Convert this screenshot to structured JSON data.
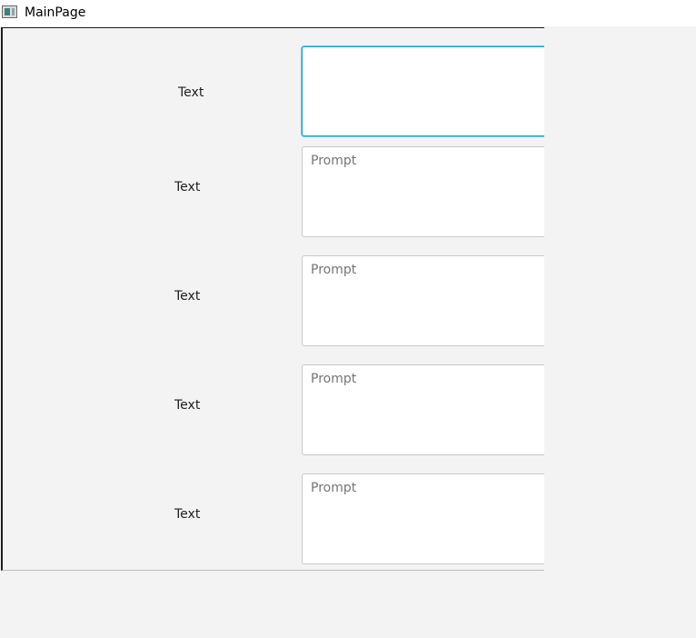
{
  "window": {
    "title": "MainPage"
  },
  "form": {
    "rows": [
      {
        "label": "Text",
        "value": "",
        "placeholder": ""
      },
      {
        "label": "Text",
        "value": "",
        "placeholder": "Prompt"
      },
      {
        "label": "Text",
        "value": "",
        "placeholder": "Prompt"
      },
      {
        "label": "Text",
        "value": "",
        "placeholder": "Prompt"
      },
      {
        "label": "Text",
        "value": "",
        "placeholder": "Prompt"
      }
    ]
  },
  "colors": {
    "focus_border": "#1ca0d8",
    "panel_background": "#f3f3f3",
    "placeholder_text": "#b4b4b4"
  },
  "icons": {
    "app_icon": "window-app-icon"
  }
}
